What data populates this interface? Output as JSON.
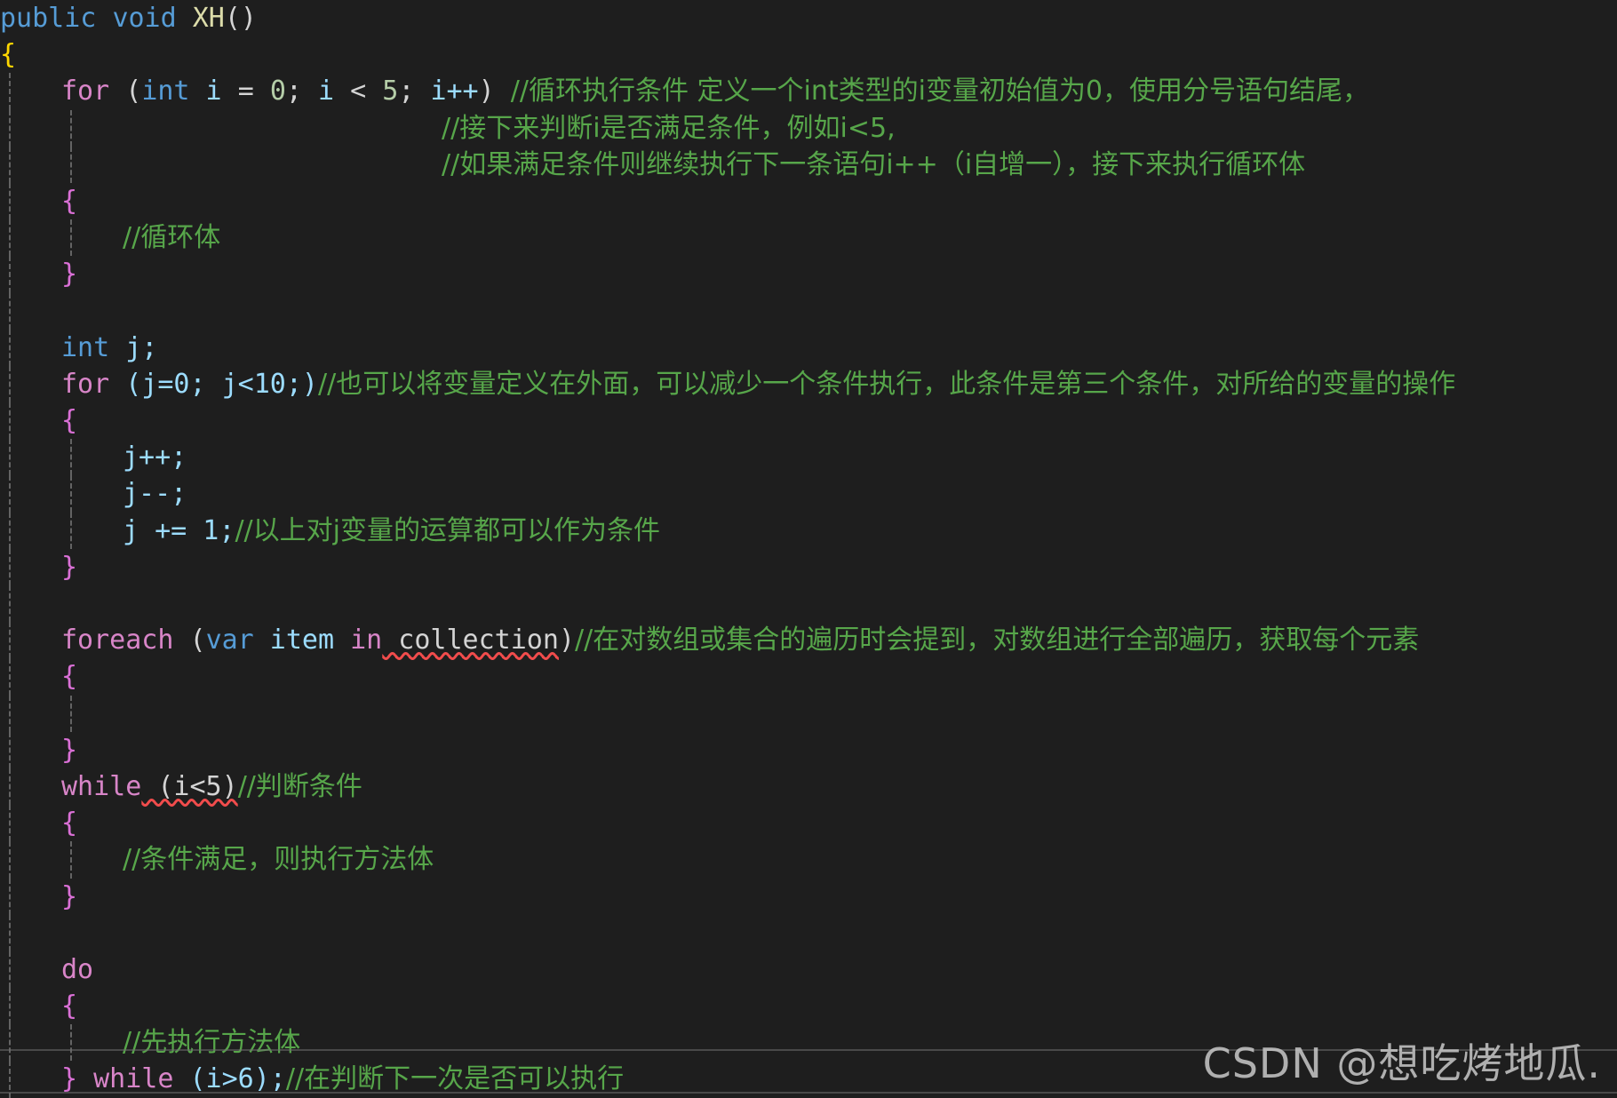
{
  "editor": {
    "theme": "vscode-dark",
    "language": "csharp",
    "background_color": "#1e1e1e",
    "foreground_color": "#d4d4d4",
    "colors": {
      "keyword": "#569cd6",
      "control_keyword": "#d885c8",
      "method": "#dcdcaa",
      "variable": "#9cdcfe",
      "number": "#b5cea8",
      "comment": "#57a64a",
      "error_squiggle": "#f14c4c",
      "indent_guide": "#707070",
      "watermark": "#c9c9c9"
    }
  },
  "code": {
    "signature": {
      "modifier": "public",
      "return_type": "void",
      "name": "XH",
      "parens": "()"
    },
    "brace_open": "{",
    "brace_close": "}",
    "for_loop": {
      "keyword": "for",
      "header": " (int i = 0; i < 5; i++) ",
      "header_parts": {
        "open": " (",
        "type": "int",
        "var": " i ",
        "assign": "= ",
        "zero": "0",
        "semi1": "; ",
        "cond_var": "i ",
        "lt": "< ",
        "five": "5",
        "semi2": "; ",
        "inc": "i++",
        "close": ") "
      },
      "comment_line_1": "//循环执行条件 定义一个int类型的i变量初始值为0，使用分号语句结尾，",
      "comment_line_2": "//接下来判断i是否满足条件，例如i<5,",
      "comment_line_3": "//如果满足条件则继续执行下一条语句i++（i自增一），接下来执行循环体",
      "body_comment": "//循环体"
    },
    "declare_j": {
      "type": "int",
      "var": " j;"
    },
    "for_loop_2": {
      "keyword": "for",
      "header": " (j=0; j<10;)",
      "comment": "//也可以将变量定义在外面，可以减少一个条件执行，此条件是第三个条件，对所给的变量的操作",
      "stmt_1": "j++;",
      "stmt_2": "j--;",
      "stmt_3": "j += 1;",
      "stmt_3_comment": "//以上对j变量的运算都可以作为条件"
    },
    "foreach_loop": {
      "keyword": "foreach",
      "open": " (",
      "var_kw": "var",
      "item": " item ",
      "in_kw": "in",
      "collection": " collection",
      "close": ")",
      "comment": "//在对数组或集合的遍历时会提到，对数组进行全部遍历，获取每个元素",
      "collection_has_error": true
    },
    "while_loop": {
      "keyword": "while",
      "condition": " (i<5)",
      "comment": "//判断条件",
      "body_comment": "//条件满足，则执行方法体",
      "condition_has_error": true
    },
    "do_loop": {
      "keyword": "do",
      "body_comment": "//先执行方法体",
      "close_brace": "} ",
      "while_keyword": "while",
      "condition": " (i>6);",
      "comment": "//在判断下一次是否可以执行"
    }
  },
  "watermark": {
    "text": "CSDN @想吃烤地瓜."
  }
}
